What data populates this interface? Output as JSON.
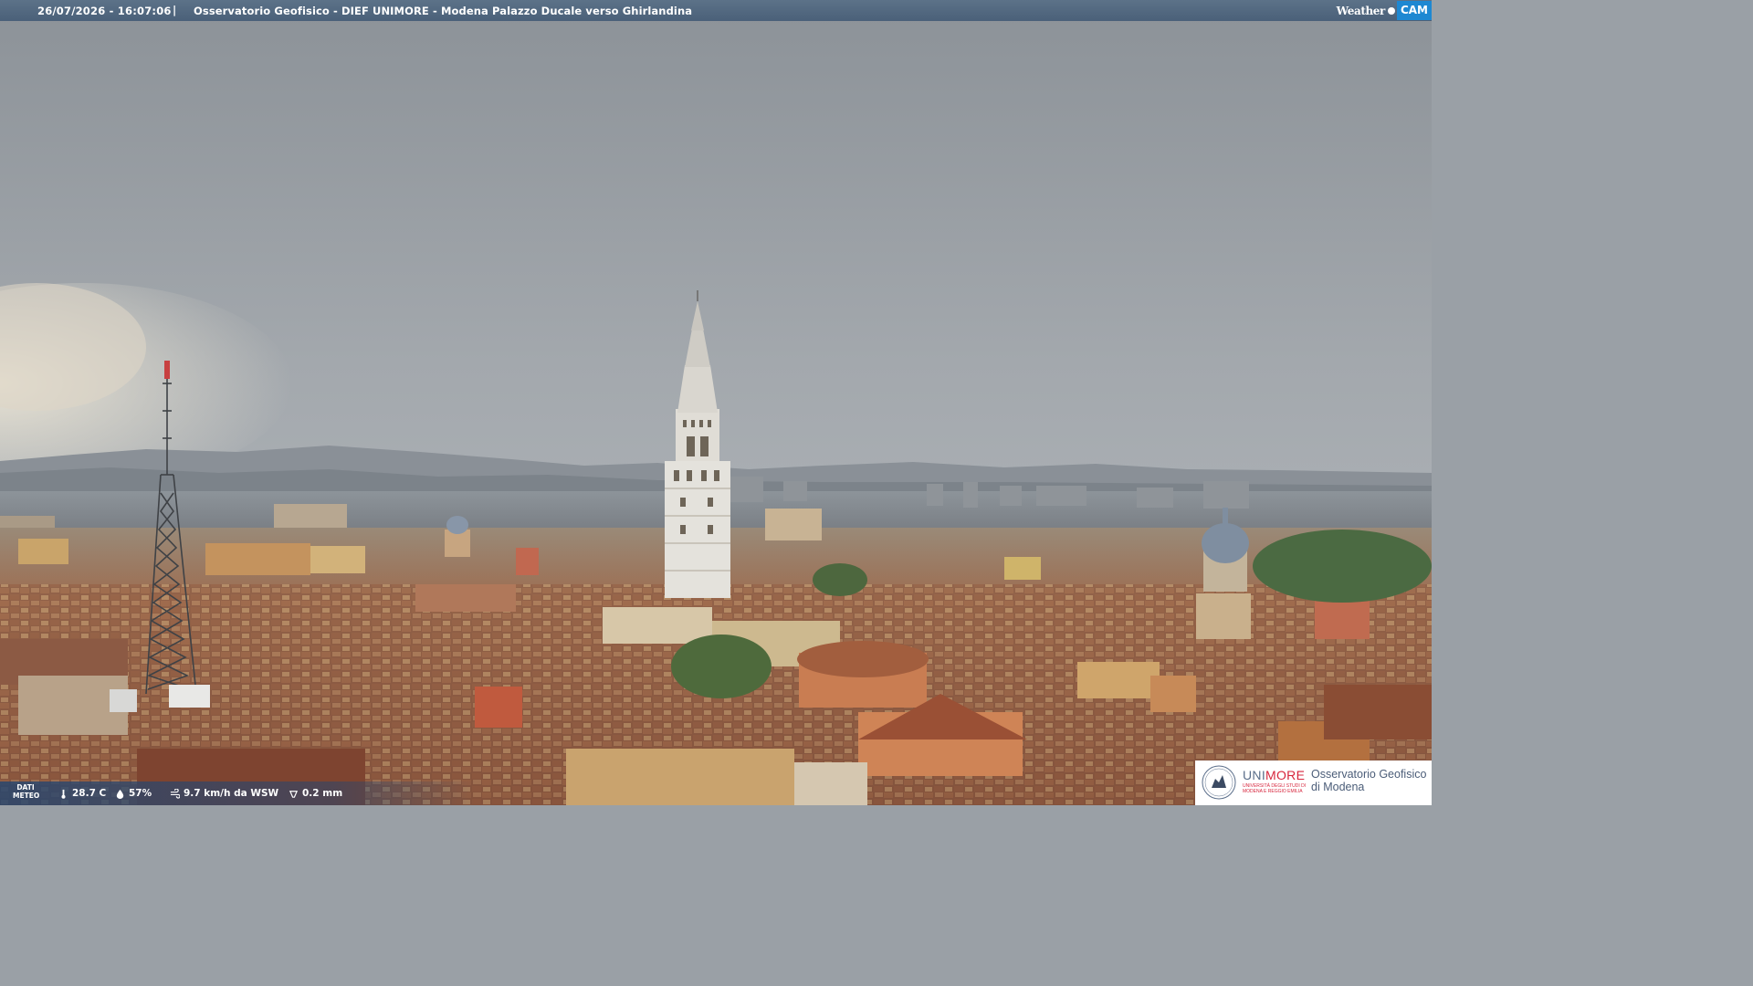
{
  "header": {
    "datetime": "26/07/2026 - 16:07:06",
    "separator": "|",
    "title": "Osservatorio Geofisico - DIEF UNIMORE - Modena Palazzo Ducale verso Ghirlandina"
  },
  "branding": {
    "weather": "Weather",
    "cam": "CAM"
  },
  "meteo": {
    "label_line1": "DATI",
    "label_line2": "METEO",
    "temperature": "28.7 C",
    "humidity": "57%",
    "wind": "9.7 km/h da WSW",
    "rain": "0.2 mm"
  },
  "logo": {
    "uni_part1": "UNI",
    "uni_part2": "MORE",
    "subtitle": "UNIVERSITÀ DEGLI STUDI DI MODENA E REGGIO EMILIA",
    "obs_line1": "Osservatorio Geofisico",
    "obs_line2": "di Modena"
  },
  "colors": {
    "header_bar": "#4a6079",
    "cam_badge": "#1e88d2",
    "unimore_red": "#d7263d"
  }
}
